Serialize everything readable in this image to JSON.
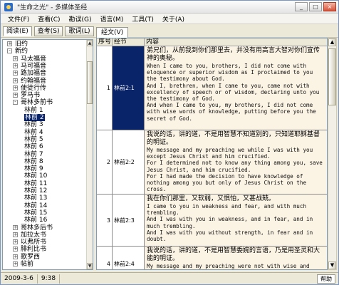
{
  "window": {
    "title": "\"生命之光\" - 多媒体圣经",
    "min_label": "_",
    "max_label": "□",
    "close_label": "×"
  },
  "menu": [
    {
      "label": "文件(F)"
    },
    {
      "label": "查看(C)"
    },
    {
      "label": "勘误(G)"
    },
    {
      "label": "语言(M)"
    },
    {
      "label": "工具(T)"
    },
    {
      "label": "关于(A)"
    }
  ],
  "toolbar": {
    "tabs": [
      {
        "label": "阅读(E)"
      },
      {
        "label": "查考(S)"
      },
      {
        "label": "歌词(L)"
      }
    ],
    "right_tab": "经文(V)"
  },
  "tree": {
    "rows": [
      {
        "label": "旧约",
        "level": 0,
        "exp": "+"
      },
      {
        "label": "新约",
        "level": 0,
        "exp": "-"
      },
      {
        "label": "马太福音",
        "level": 1,
        "exp": "+"
      },
      {
        "label": "马可福音",
        "level": 1,
        "exp": "+"
      },
      {
        "label": "路加福音",
        "level": 1,
        "exp": "+"
      },
      {
        "label": "约翰福音",
        "level": 1,
        "exp": "+"
      },
      {
        "label": "使徒行传",
        "level": 1,
        "exp": "+"
      },
      {
        "label": "罗马书",
        "level": 1,
        "exp": "+"
      },
      {
        "label": "哥林多前书",
        "level": 1,
        "exp": "-"
      },
      {
        "label": "林前 1",
        "level": 2
      },
      {
        "label": "林前 2",
        "level": 2,
        "selected": true
      },
      {
        "label": "林前 3",
        "level": 2
      },
      {
        "label": "林前 4",
        "level": 2
      },
      {
        "label": "林前 5",
        "level": 2
      },
      {
        "label": "林前 6",
        "level": 2
      },
      {
        "label": "林前 7",
        "level": 2
      },
      {
        "label": "林前 8",
        "level": 2
      },
      {
        "label": "林前 9",
        "level": 2
      },
      {
        "label": "林前 10",
        "level": 2
      },
      {
        "label": "林前 11",
        "level": 2
      },
      {
        "label": "林前 12",
        "level": 2
      },
      {
        "label": "林前 13",
        "level": 2
      },
      {
        "label": "林前 14",
        "level": 2
      },
      {
        "label": "林前 15",
        "level": 2
      },
      {
        "label": "林前 16",
        "level": 2
      },
      {
        "label": "哥林多后书",
        "level": 1,
        "exp": "+"
      },
      {
        "label": "加拉太书",
        "level": 1,
        "exp": "+"
      },
      {
        "label": "以弗所书",
        "level": 1,
        "exp": "+"
      },
      {
        "label": "腓利比书",
        "level": 1,
        "exp": "+"
      },
      {
        "label": "歌罗西",
        "level": 1,
        "exp": "+"
      },
      {
        "label": "帖前",
        "level": 1,
        "exp": "+"
      }
    ]
  },
  "grid": {
    "headers": {
      "idx": "序号",
      "ref": "经节",
      "text": "内容"
    },
    "rows": [
      {
        "idx": "1",
        "ref": "林前2:1",
        "selected": true,
        "zh": "弟兄们，从前我到你们那里去，并没有用高言大智对你们宣传神的奥秘。",
        "en": "When I came to you, brothers, I did not come with\neloquence or superior wisdom as I proclaimed to you\nthe testimony about God.\nAnd I, brethren, when I came to you, came not with\nexcellency of speech or of wisdom, declaring unto you\nthe testimony of God.\nAnd when I came to you, my brothers, I did not come\nwith wise words of knowledge, putting before you the\nsecret of God."
      },
      {
        "idx": "2",
        "ref": "林前2:2",
        "selected": false,
        "zh": "我说的话，讲的道，不是用智慧不知道别的，只知道耶稣基督的明证。",
        "en": "My message and my preaching we while I was with you\nexcept Jesus Christ and him crucified.\nFor I determined not to know any thing among you, save\nJesus Christ, and him crucified.\nFor I had made the decision to have knowledge of\nnothing among you but only of Jesus Christ on the\ncross."
      },
      {
        "idx": "3",
        "ref": "林前2:3",
        "selected": false,
        "zh": "我在你们那里，又软弱，又惧怕，又甚战兢。",
        "en": "I came to you in weakness and fear, and with much\ntrembling.\nAnd I was with you in weakness, and in fear, and in\nmuch trembling.\nAnd I was with you without strength, in fear and in\ndoubt."
      },
      {
        "idx": "4",
        "ref": "林前2:4",
        "selected": false,
        "zh": "我说的话，讲的道，不是用智慧委婉的言语，乃是用圣灵和大能的明证。",
        "en": "My message and my preaching were not with wise and\npersuasive words, but with a demonstration of the\nSpirit's power,"
      }
    ]
  },
  "status": {
    "date": "2009-3-6",
    "time": "9:38",
    "right_label": "帮助"
  }
}
